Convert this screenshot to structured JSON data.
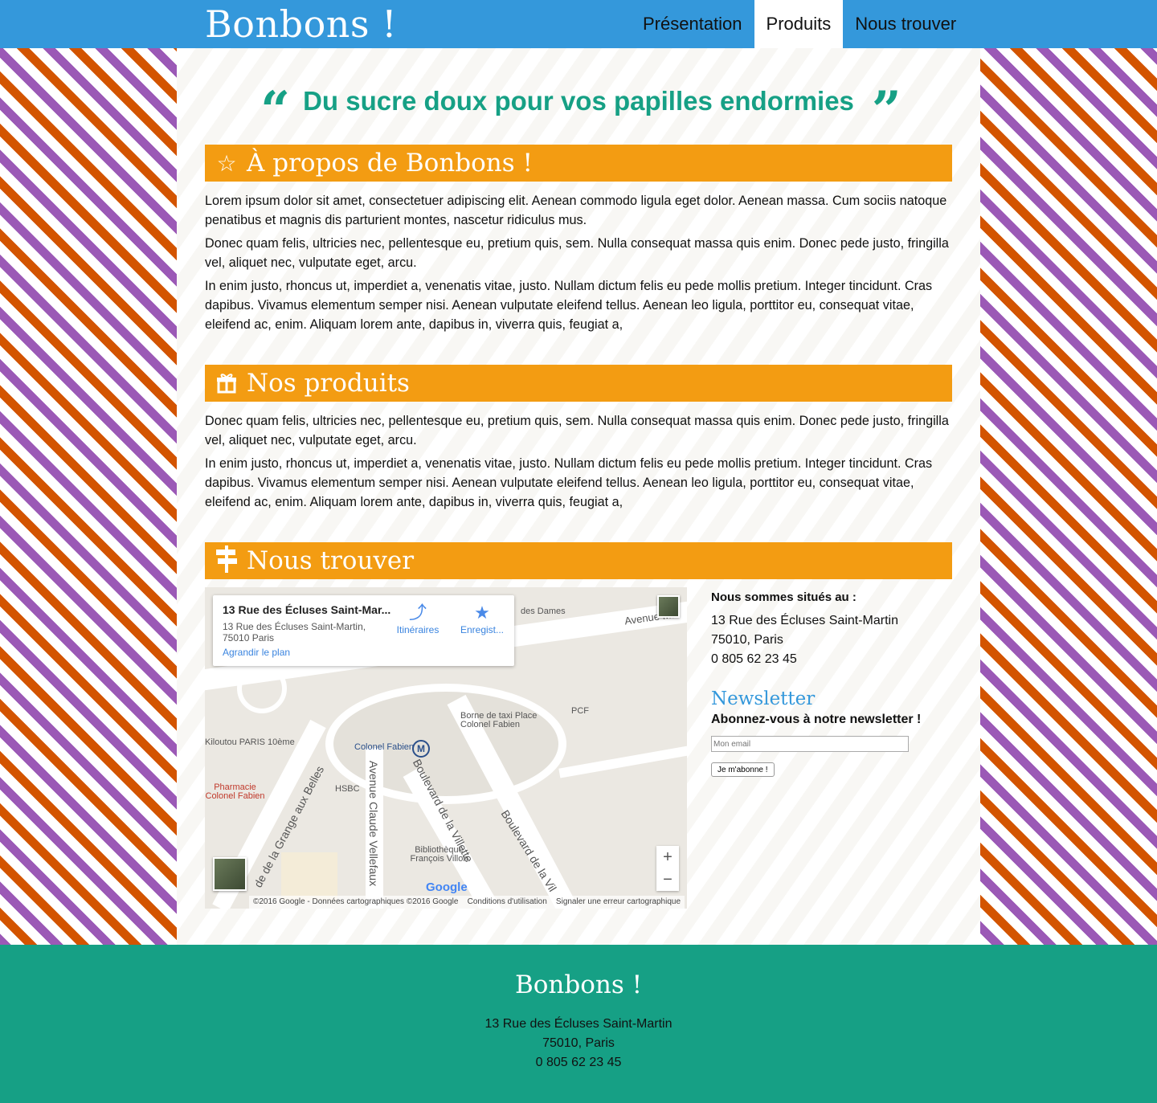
{
  "header": {
    "brand": "Bonbons !",
    "nav": [
      {
        "label": "Présentation"
      },
      {
        "label": "Produits"
      },
      {
        "label": "Nous trouver"
      }
    ]
  },
  "quote": "Du sucre doux pour vos papilles endormies",
  "about": {
    "title": "À propos de Bonbons !",
    "icon": "star-icon",
    "paragraphs": [
      "Lorem ipsum dolor sit amet, consectetuer adipiscing elit. Aenean commodo ligula eget dolor. Aenean massa. Cum sociis natoque penatibus et magnis dis parturient montes, nascetur ridiculus mus.",
      "Donec quam felis, ultricies nec, pellentesque eu, pretium quis, sem. Nulla consequat massa quis enim. Donec pede justo, fringilla vel, aliquet nec, vulputate eget, arcu.",
      "In enim justo, rhoncus ut, imperdiet a, venenatis vitae, justo. Nullam dictum felis eu pede mollis pretium. Integer tincidunt. Cras dapibus. Vivamus elementum semper nisi. Aenean vulputate eleifend tellus. Aenean leo ligula, porttitor eu, consequat vitae, eleifend ac, enim. Aliquam lorem ante, dapibus in, viverra quis, feugiat a,"
    ]
  },
  "products": {
    "title": "Nos produits",
    "icon": "gift-icon",
    "paragraphs": [
      "Donec quam felis, ultricies nec, pellentesque eu, pretium quis, sem. Nulla consequat massa quis enim. Donec pede justo, fringilla vel, aliquet nec, vulputate eget, arcu.",
      "In enim justo, rhoncus ut, imperdiet a, venenatis vitae, justo. Nullam dictum felis eu pede mollis pretium. Integer tincidunt. Cras dapibus. Vivamus elementum semper nisi. Aenean vulputate eleifend tellus. Aenean leo ligula, porttitor eu, consequat vitae, eleifend ac, enim. Aliquam lorem ante, dapibus in, viverra quis, feugiat a,"
    ]
  },
  "find": {
    "title": "Nous trouver",
    "icon": "signpost-icon",
    "map": {
      "card_title": "13 Rue des Écluses Saint-Mar...",
      "card_address_1": "13 Rue des Écluses Saint-Martin,",
      "card_address_2": "75010 Paris",
      "enlarge": "Agrandir le plan",
      "directions": "Itinéraires",
      "save": "Enregist...",
      "labels": {
        "avenue_ma": "Avenue Ma",
        "des_dames": "des Dames",
        "borne_taxi": "Borne de taxi Place Colonel Fabien",
        "pcf": "PCF",
        "kiloutou": "Kiloutou PARIS 10ème",
        "colonel_fabien": "Colonel Fabien",
        "metro": "M",
        "pharmacie": "Pharmacie Colonel Fabien",
        "hsbc": "HSBC",
        "bibliotheque": "Bibliothèque François Villon",
        "grange": "de de la Grange aux Belles",
        "claude": "Avenue Claude Vellefaux",
        "villette1": "Boulevard de la Villette",
        "villette2": "Boulevard de la Vil"
      },
      "google": "Google",
      "copyright": "©2016 Google - Données cartographiques ©2016 Google",
      "terms": "Conditions d'utilisation",
      "report": "Signaler une erreur cartographique",
      "zoom_in": "+",
      "zoom_out": "−"
    },
    "located_label": "Nous sommes situés au :",
    "address_line1": "13 Rue des Écluses Saint-Martin",
    "address_line2": "75010, Paris",
    "phone": "0 805 62 23 45",
    "newsletter": {
      "title": "Newsletter",
      "subtitle": "Abonnez-vous à notre newsletter !",
      "placeholder": "Mon email",
      "button": "Je m'abonne !"
    }
  },
  "footer": {
    "brand": "Bonbons !",
    "address_line1": "13 Rue des Écluses Saint-Martin",
    "address_line2": "75010, Paris",
    "phone": "0 805 62 23 45"
  },
  "colors": {
    "header_blue": "#3498db",
    "section_orange": "#f39c12",
    "accent_green": "#16a085",
    "stripe_purple": "#9b59b6",
    "stripe_orange": "#d35400"
  }
}
